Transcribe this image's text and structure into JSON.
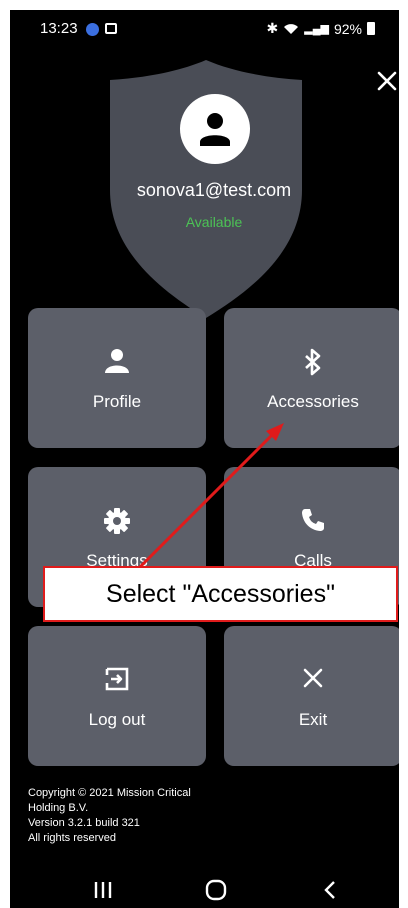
{
  "status_bar": {
    "time": "13:23",
    "battery": "92%"
  },
  "profile": {
    "email": "sonova1@test.com",
    "availability": "Available"
  },
  "menu": {
    "profile_label": "Profile",
    "accessories_label": "Accessories",
    "settings_label": "Settings",
    "calls_label": "Calls",
    "logout_label": "Log out",
    "exit_label": "Exit"
  },
  "footer": {
    "copyright_line1": "Copyright © 2021 Mission Critical",
    "copyright_line2": "Holding B.V.",
    "version": "Version 3.2.1 build 321",
    "rights": "All rights reserved"
  },
  "annotation": {
    "callout_text": "Select \"Accessories\""
  },
  "colors": {
    "background": "#000000",
    "tile": "#5c5f69",
    "shield": "#4a4d56",
    "available": "#4cc255",
    "callout_border": "#e01b1b"
  }
}
